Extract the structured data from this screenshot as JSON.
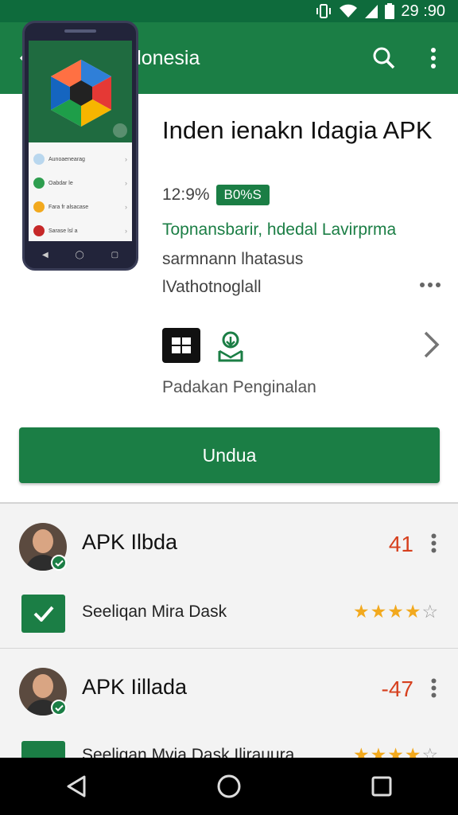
{
  "status_bar": {
    "time": "29 :90",
    "icons": [
      "vibrate-icon",
      "wifi-icon",
      "signal-icon",
      "battery-icon"
    ]
  },
  "app_bar": {
    "title": "APK Indonesia",
    "icons": [
      "back-arrow-icon",
      "search-icon",
      "more-vert-icon"
    ]
  },
  "app": {
    "name": "Inden ienakn Idagia APK",
    "rating_percent": "12:9%",
    "badge": "B0%S",
    "developer": "Topnansbarir, hdedal Lavirprma",
    "description_line1": "sarmnann lhatasus",
    "description_line2": "lVathotnoglall",
    "category": "Padakan Penginalan",
    "install_button": "Undua",
    "screenshot_rows": [
      "Aunoaenearag",
      "Oabdar le",
      "Fara fr alsacase",
      "Sarase lsl a"
    ]
  },
  "reviews": [
    {
      "name": "APK Ilbda",
      "score": "41",
      "comment": "Seeliqan Mira Dask",
      "stars": 4
    },
    {
      "name": "APK Iillada",
      "score": "-47",
      "comment": "Seeliqan Mvia Dask Ilirauura",
      "stars": 4
    }
  ],
  "colors": {
    "primary": "#1b7e45",
    "status_bar": "#0e6b3c",
    "score_red": "#d6401e",
    "star": "#f2a91e"
  },
  "nav_bar": {
    "icons": [
      "nav-back-icon",
      "nav-home-icon",
      "nav-recents-icon"
    ]
  }
}
